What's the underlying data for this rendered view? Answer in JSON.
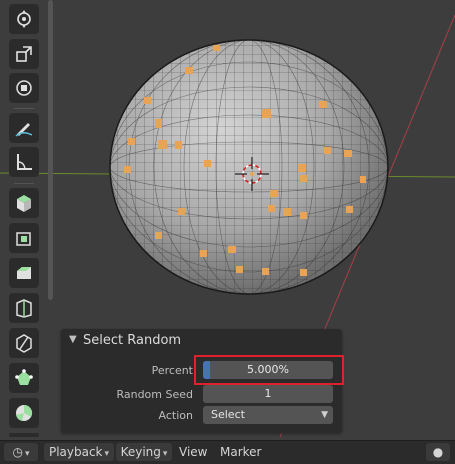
{
  "viewport": {
    "toolbar": {
      "tools": [
        {
          "name": "transform-icon"
        },
        {
          "name": "scale-icon"
        },
        {
          "name": "transform-gizmo-icon"
        },
        {
          "name": "annotate-icon"
        },
        {
          "name": "measure-icon"
        },
        {
          "name": "add-cube-icon"
        },
        {
          "name": "extrude-region-icon"
        },
        {
          "name": "inset-faces-icon"
        },
        {
          "name": "bevel-icon"
        },
        {
          "name": "loop-cut-icon"
        },
        {
          "name": "knife-icon"
        },
        {
          "name": "poly-build-icon"
        },
        {
          "name": "spin-icon"
        }
      ]
    }
  },
  "redo_panel": {
    "title": "Select Random",
    "properties": {
      "percent": {
        "label": "Percent",
        "value": "5.000%",
        "fraction": 0.05
      },
      "random_seed": {
        "label": "Random Seed",
        "value": "1"
      },
      "action": {
        "label": "Action",
        "value": "Select"
      }
    }
  },
  "timeline": {
    "playback_label": "Playback",
    "keying_label": "Keying",
    "view_label": "View",
    "marker_label": "Marker"
  },
  "colors": {
    "viewport_bg": "#3d3d3d",
    "mesh_face": "#9a9a9a",
    "selected_face": "#e8a454",
    "highlight_box": "#e0202a",
    "slider_fill": "#4772b3",
    "x_axis": "#b0404a",
    "y_axis": "#6a8c2a"
  }
}
